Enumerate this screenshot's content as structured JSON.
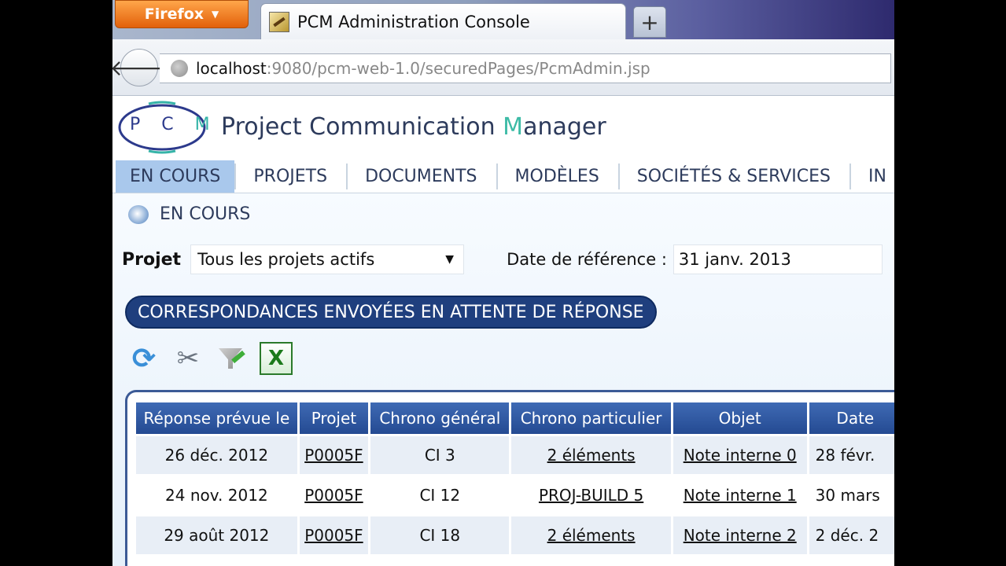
{
  "browser": {
    "menu_button": "Firefox",
    "tab_title": "PCM Administration Console",
    "new_tab": "+",
    "url_host": "localhost",
    "url_path": ":9080/pcm-web-1.0/securedPages/PcmAdmin.jsp"
  },
  "app": {
    "logo_letters": "P C",
    "logo_m": "M",
    "title_pre": "Project Communication ",
    "title_m": "M",
    "title_post": "anager"
  },
  "menu": [
    "EN COURS",
    "PROJETS",
    "DOCUMENTS",
    "MODÈLES",
    "SOCIÉTÉS & SERVICES",
    "IN"
  ],
  "breadcrumb": "EN COURS",
  "filters": {
    "projet_label": "Projet",
    "projet_value": "Tous les projets actifs",
    "date_label": "Date de référence :",
    "date_value": "31 janv. 2013"
  },
  "section_title": "CORRESPONDANCES ENVOYÉES EN ATTENTE DE RÉPONSE",
  "toolbar_icons": [
    "refresh-icon",
    "tools-icon",
    "filter-icon",
    "excel-icon"
  ],
  "excel_glyph": "X",
  "table": {
    "headers": [
      "Réponse prévue le",
      "Projet",
      "Chrono général",
      "Chrono particulier",
      "Objet",
      "Date"
    ],
    "rows": [
      [
        "26 déc. 2012",
        "P0005F",
        "CI 3",
        "2 éléments",
        "Note interne 0",
        "28 févr."
      ],
      [
        "24 nov. 2012",
        "P0005F",
        "CI 12",
        "PROJ-BUILD 5",
        "Note interne 1",
        "30 mars"
      ],
      [
        "29 août 2012",
        "P0005F",
        "CI 18",
        "2 éléments",
        "Note interne 2",
        "2 déc. 2"
      ]
    ]
  }
}
